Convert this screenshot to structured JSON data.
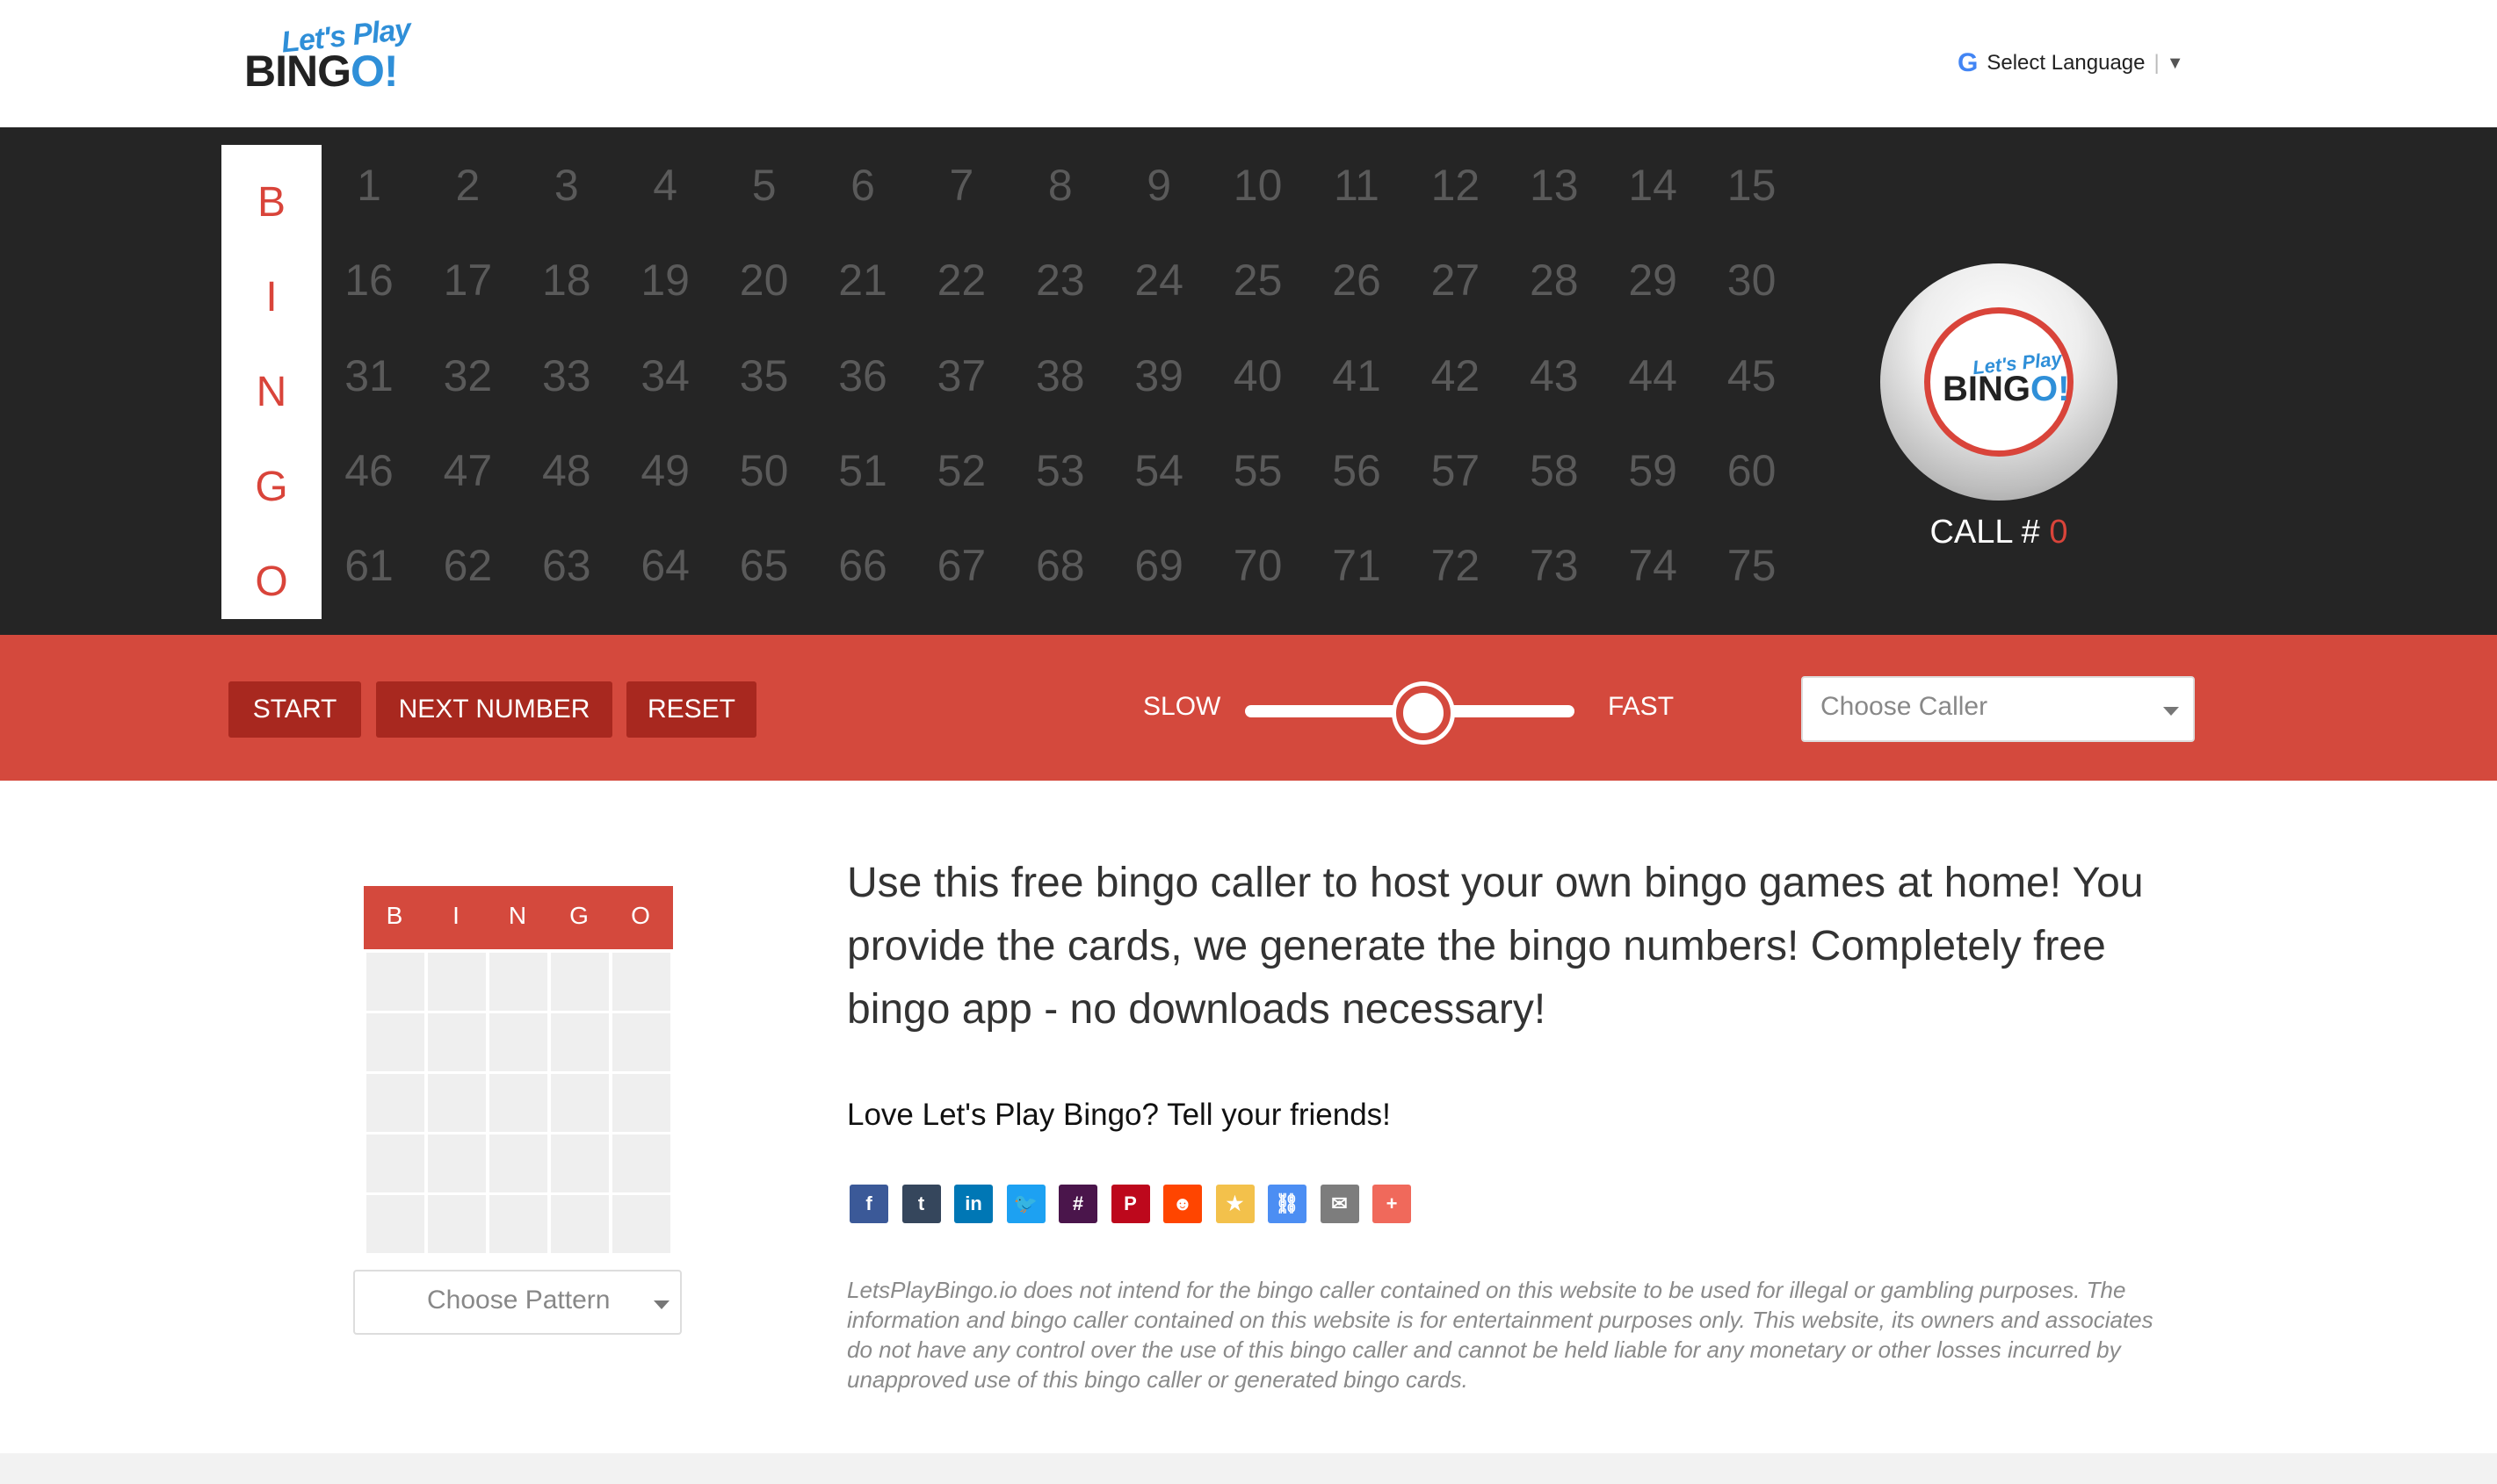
{
  "header": {
    "logo_line1": "Let's Play",
    "logo_line2_a": "BING",
    "logo_line2_b": "O!",
    "language_label": "Select Language",
    "language_arrow": "▼"
  },
  "board": {
    "letters": [
      "B",
      "I",
      "N",
      "G",
      "O"
    ],
    "rows": [
      [
        "1",
        "2",
        "3",
        "4",
        "5",
        "6",
        "7",
        "8",
        "9",
        "10",
        "11",
        "12",
        "13",
        "14",
        "15"
      ],
      [
        "16",
        "17",
        "18",
        "19",
        "20",
        "21",
        "22",
        "23",
        "24",
        "25",
        "26",
        "27",
        "28",
        "29",
        "30"
      ],
      [
        "31",
        "32",
        "33",
        "34",
        "35",
        "36",
        "37",
        "38",
        "39",
        "40",
        "41",
        "42",
        "43",
        "44",
        "45"
      ],
      [
        "46",
        "47",
        "48",
        "49",
        "50",
        "51",
        "52",
        "53",
        "54",
        "55",
        "56",
        "57",
        "58",
        "59",
        "60"
      ],
      [
        "61",
        "62",
        "63",
        "64",
        "65",
        "66",
        "67",
        "68",
        "69",
        "70",
        "71",
        "72",
        "73",
        "74",
        "75"
      ]
    ],
    "ball_logo_line1": "Let's Play",
    "ball_logo_line2_a": "BING",
    "ball_logo_line2_b": "O!",
    "call_label": "CALL # ",
    "call_number": "0"
  },
  "controls": {
    "start_label": "START",
    "next_label": "NEXT NUMBER",
    "reset_label": "RESET",
    "slow_label": "SLOW",
    "fast_label": "FAST",
    "speed_fraction": 0.54,
    "caller_placeholder": "Choose Caller"
  },
  "card": {
    "header": [
      "B",
      "I",
      "N",
      "G",
      "O"
    ],
    "pattern_placeholder": "Choose Pattern"
  },
  "content": {
    "description": "Use this free bingo caller to host your own bingo games at home! You provide the cards, we generate the bingo numbers! Completely free bingo app - no downloads necessary!",
    "share_title": "Love Let's Play Bingo? Tell your friends!",
    "disclaimer": "LetsPlayBingo.io does not intend for the bingo caller contained on this website to be used for illegal or gambling purposes. The information and bingo caller contained on this website is for entertainment purposes only. This website, its owners and associates do not have any control over the use of this bingo caller and cannot be held liable for any monetary or other losses incurred by unapproved use of this bingo caller or generated bingo cards."
  },
  "share_buttons": [
    {
      "name": "facebook-share-icon",
      "glyph": "f",
      "color": "#3b5998"
    },
    {
      "name": "tumblr-share-icon",
      "glyph": "t",
      "color": "#35465c"
    },
    {
      "name": "linkedin-share-icon",
      "glyph": "in",
      "color": "#0077b5"
    },
    {
      "name": "twitter-share-icon",
      "glyph": "🐦",
      "color": "#1da1f2"
    },
    {
      "name": "slack-share-icon",
      "glyph": "#",
      "color": "#4a154b"
    },
    {
      "name": "pinterest-share-icon",
      "glyph": "P",
      "color": "#bd081c"
    },
    {
      "name": "reddit-share-icon",
      "glyph": "☻",
      "color": "#ff4500"
    },
    {
      "name": "favorite-share-icon",
      "glyph": "★",
      "color": "#f3c14b"
    },
    {
      "name": "copy-link-share-icon",
      "glyph": "⛓",
      "color": "#4c8ef3"
    },
    {
      "name": "email-share-icon",
      "glyph": "✉",
      "color": "#7d7d7d"
    },
    {
      "name": "more-share-icon",
      "glyph": "+",
      "color": "#f0695b"
    }
  ],
  "colors": {
    "accent_red": "#d4493d",
    "button_dark_red": "#a8281f",
    "board_bg": "#252525",
    "uncalled_number": "#5a5a5a",
    "logo_blue": "#2f8fd8"
  }
}
